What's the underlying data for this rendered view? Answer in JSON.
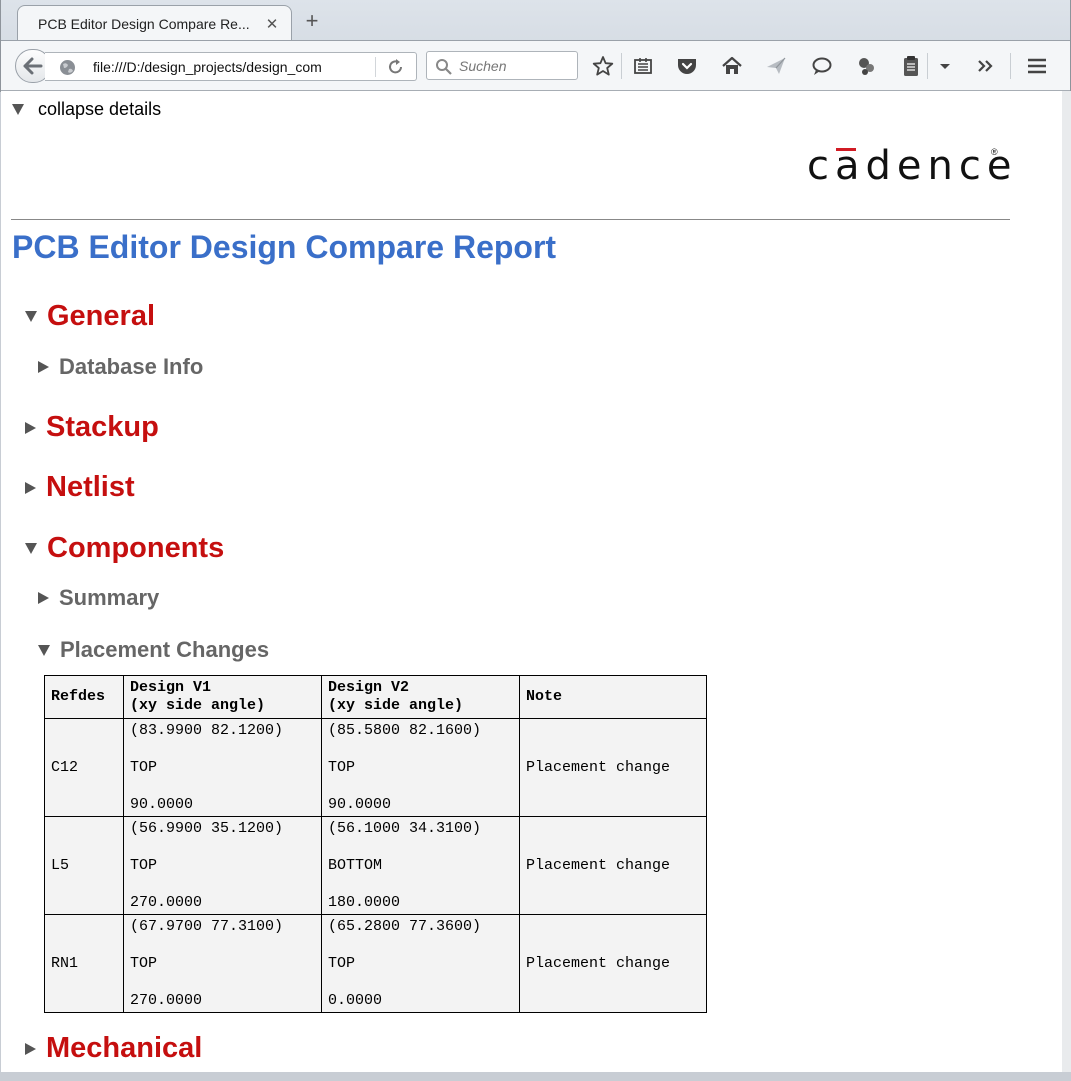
{
  "browser": {
    "tab_title": "PCB Editor Design Compare Re...",
    "url": "file:///D:/design_projects/design_com",
    "search_placeholder": "Suchen",
    "toolbar_icons": [
      "bookmark-star-icon",
      "reading-list-icon",
      "pocket-icon",
      "home-icon",
      "send-icon",
      "chat-icon",
      "share-icon",
      "clipboard-icon",
      "dropdown-icon",
      "overflow-icon",
      "menu-icon"
    ]
  },
  "page": {
    "collapse_label": "collapse details",
    "logo_text": "cadence",
    "title": "PCB Editor Design Compare Report",
    "sections": {
      "general": "General",
      "database_info": "Database Info",
      "stackup": "Stackup",
      "netlist": "Netlist",
      "components": "Components",
      "summary": "Summary",
      "placement_changes": "Placement Changes",
      "mechanical": "Mechanical"
    },
    "table": {
      "headers": {
        "refdes": "Refdes",
        "v1_line1": "Design V1",
        "v1_line2": "(xy side angle)",
        "v2_line1": "Design V2",
        "v2_line2": "(xy side angle)",
        "note": "Note"
      },
      "rows": [
        {
          "refdes": "C12",
          "v1_xy": "(83.9900 82.1200)",
          "v1_side": "TOP",
          "v1_angle": "90.0000",
          "v2_xy": "(85.5800 82.1600)",
          "v2_side": "TOP",
          "v2_angle": "90.0000",
          "note": "Placement change"
        },
        {
          "refdes": "L5",
          "v1_xy": "(56.9900 35.1200)",
          "v1_side": "TOP",
          "v1_angle": "270.0000",
          "v2_xy": "(56.1000 34.3100)",
          "v2_side": "BOTTOM",
          "v2_angle": "180.0000",
          "note": "Placement change"
        },
        {
          "refdes": "RN1",
          "v1_xy": "(67.9700 77.3100)",
          "v1_side": "TOP",
          "v1_angle": "270.0000",
          "v2_xy": "(65.2800 77.3600)",
          "v2_side": "TOP",
          "v2_angle": "0.0000",
          "note": "Placement change"
        }
      ]
    }
  },
  "colors": {
    "title_blue": "#3a6fc9",
    "section_red": "#c50f0f",
    "subsection_gray": "#666666",
    "logo_accent": "#d11b24"
  }
}
